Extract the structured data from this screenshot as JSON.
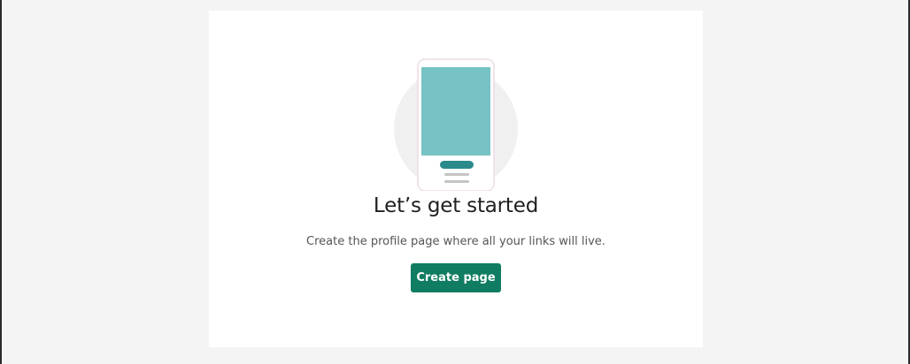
{
  "empty_state": {
    "heading": "Let’s get started",
    "description": "Create the profile page where all your links will live.",
    "create_button_label": "Create page"
  },
  "colors": {
    "page_background": "#f4f4f4",
    "card_background": "#ffffff",
    "accent_button": "#107c62",
    "phone_screen": "#76c2c4",
    "phone_button": "#2b8a8c",
    "circle_backdrop": "#f0f0f0"
  },
  "icons": {
    "illustration": "phone-profile-illustration"
  }
}
